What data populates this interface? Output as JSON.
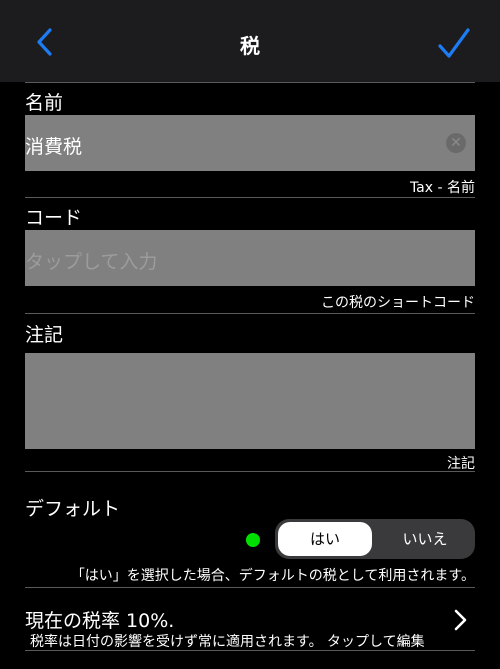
{
  "nav": {
    "title": "税"
  },
  "name_section": {
    "label": "名前",
    "value": "消費税",
    "hint": "Tax - 名前"
  },
  "code_section": {
    "label": "コード",
    "placeholder": "タップして入力",
    "hint": "この税のショートコード"
  },
  "note_section": {
    "label": "注記",
    "hint": "注記"
  },
  "default_section": {
    "label": "デフォルト",
    "yes": "はい",
    "no": "いいえ",
    "selected": "はい",
    "description": "「はい」を選択した場合、デフォルトの税として利用されます。"
  },
  "rate_section": {
    "title": "現在の税率 10%.",
    "subtitle": "税率は日付の影響を受けず常に適用されます。 タップして編集"
  },
  "colors": {
    "accent": "#1d7cf2",
    "background": "#000000",
    "navbar": "#1c1c1e",
    "field": "#808080",
    "status_green": "#00e000"
  }
}
